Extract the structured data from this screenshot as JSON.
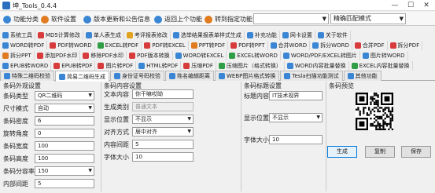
{
  "window": {
    "title": "坤_Tools_0.4.4",
    "minimize": "—",
    "maximize": "☐",
    "close": "✕"
  },
  "toolbar": {
    "items": [
      {
        "label": "功能分类",
        "icon": "gear-icon",
        "color": "#3a86d4"
      },
      {
        "label": "软件设置",
        "icon": "settings-icon",
        "color": "#e07b1f"
      },
      {
        "label": "版本更新和公告信息",
        "icon": "info-icon",
        "color": "#3a86d4"
      },
      {
        "label": "返回上个功能",
        "icon": "back-arrow-icon",
        "color": "#3a86d4"
      },
      {
        "label": "转到指定功能",
        "icon": "forward-icon",
        "color": "#e07b1f"
      }
    ],
    "search_placeholder": "",
    "match_mode": "精确匹配模式"
  },
  "nav_rows": [
    [
      {
        "label": "系统工具",
        "color": "#3a86d4"
      },
      {
        "label": "MD5计算修改",
        "color": "#d83b3b"
      },
      {
        "label": "单人表生成",
        "color": "#3a86d4"
      },
      {
        "label": "考评报表修改",
        "color": "#e0a21f"
      },
      {
        "label": "选举结果报表单样式生成",
        "color": "#3a86d4"
      },
      {
        "label": "补充功能",
        "color": "#3a86d4"
      },
      {
        "label": "网卡设置",
        "color": "#3a86d4"
      },
      {
        "label": "关于软件",
        "color": "#3a86d4"
      }
    ],
    [
      {
        "label": "WORD转PDF",
        "color": "#3a86d4"
      },
      {
        "label": "PDF转WORD",
        "color": "#d83b3b"
      },
      {
        "label": "EXCEL转PDF",
        "color": "#2f9e44"
      },
      {
        "label": "PDF转EXCEL",
        "color": "#d83b3b"
      },
      {
        "label": "PPT转PDF",
        "color": "#e07b1f"
      },
      {
        "label": "PDF转PPT",
        "color": "#d83b3b"
      },
      {
        "label": "合并WORD",
        "color": "#3a86d4"
      },
      {
        "label": "拆分WORD",
        "color": "#3a86d4"
      },
      {
        "label": "合并PDF",
        "color": "#d83b3b"
      },
      {
        "label": "拆分PDF",
        "color": "#d83b3b"
      }
    ],
    [
      {
        "label": "拆分PPT",
        "color": "#e07b1f"
      },
      {
        "label": "添加PDF水印",
        "color": "#d83b3b"
      },
      {
        "label": "移除PDF水印",
        "color": "#d83b3b"
      },
      {
        "label": "PDF版本转换",
        "color": "#d83b3b"
      },
      {
        "label": "WORD转EXCEL",
        "color": "#3a86d4"
      },
      {
        "label": "EXCEL转WORD",
        "color": "#2f9e44"
      },
      {
        "label": "WORD/PDF/EXCEL转图片",
        "color": "#3a86d4"
      },
      {
        "label": "图片转WORD",
        "color": "#3a86d4"
      }
    ],
    [
      {
        "label": "EPUB转WORD",
        "color": "#3a86d4"
      },
      {
        "label": "EPUB转PDF",
        "color": "#d83b3b"
      },
      {
        "label": "图片转PDF",
        "color": "#d83b3b"
      },
      {
        "label": "HTML转PDF",
        "color": "#3a86d4"
      },
      {
        "label": "压缩PDF",
        "color": "#d83b3b"
      },
      {
        "label": "压缩图片（格式转换）",
        "color": "#2f9e44"
      },
      {
        "label": "WORD内容批量替换",
        "color": "#3a86d4"
      },
      {
        "label": "EXCEL内容批量替换",
        "color": "#2f9e44"
      }
    ]
  ],
  "tabs": [
    {
      "label": "特殊二维码校验",
      "active": false,
      "color": "#3a86d4"
    },
    {
      "label": "简易二维码生成",
      "active": true,
      "color": "#3a86d4"
    },
    {
      "label": "身份证号码校验",
      "active": false,
      "color": "#3a86d4"
    },
    {
      "label": "姓名编辑距离",
      "active": false,
      "color": "#3a86d4"
    },
    {
      "label": "WEBP图片格式转换",
      "active": false,
      "color": "#3a86d4"
    },
    {
      "label": "Tesla扫描功能测试",
      "active": false,
      "color": "#3a86d4"
    },
    {
      "label": "其他功能",
      "active": false,
      "color": "#3a86d4"
    }
  ],
  "settings": {
    "section_title": "条码外观设置",
    "rows": [
      {
        "label": "条码类型",
        "value": "QR二维码",
        "kind": "combo"
      },
      {
        "label": "尺寸模式",
        "value": "自动",
        "kind": "combo"
      },
      {
        "label": "条码密度",
        "value": "6",
        "kind": "input"
      },
      {
        "label": "旋转角度",
        "value": "0",
        "kind": "input"
      },
      {
        "label": "条码宽度",
        "value": "100",
        "kind": "input"
      },
      {
        "label": "条码高度",
        "value": "100",
        "kind": "input"
      },
      {
        "label": "条码分容率",
        "value": "150",
        "kind": "combo"
      },
      {
        "label": "内部间距",
        "value": "5",
        "kind": "input"
      }
    ]
  },
  "content": {
    "section_title": "条码内容设置",
    "rows": [
      {
        "label": "文本内容",
        "value": "你干嘛哎呦",
        "kind": "input",
        "disabled": false
      },
      {
        "label": "生成类别",
        "value": "普通文本",
        "kind": "input",
        "disabled": true
      },
      {
        "label": "显示位置",
        "value": "不显示",
        "kind": "combo",
        "disabled": false
      },
      {
        "label": "对齐方式",
        "value": "居中对齐",
        "kind": "combo",
        "disabled": false
      },
      {
        "label": "内容间距",
        "value": "5",
        "kind": "input",
        "disabled": false
      },
      {
        "label": "字体大小",
        "value": "10",
        "kind": "input",
        "disabled": false
      }
    ]
  },
  "title_settings": {
    "section_title": "条码标题设置",
    "rows": [
      {
        "label": "标题内容",
        "value": "IT技术视界",
        "kind": "input"
      },
      {
        "label": "显示位置",
        "value": "不显示",
        "kind": "combo"
      },
      {
        "label": "字体大小",
        "value": "10",
        "kind": "input"
      }
    ]
  },
  "preview": {
    "section_title": "条码预览"
  },
  "actions": {
    "generate": "生成",
    "copy": "复制",
    "save": "保存"
  }
}
